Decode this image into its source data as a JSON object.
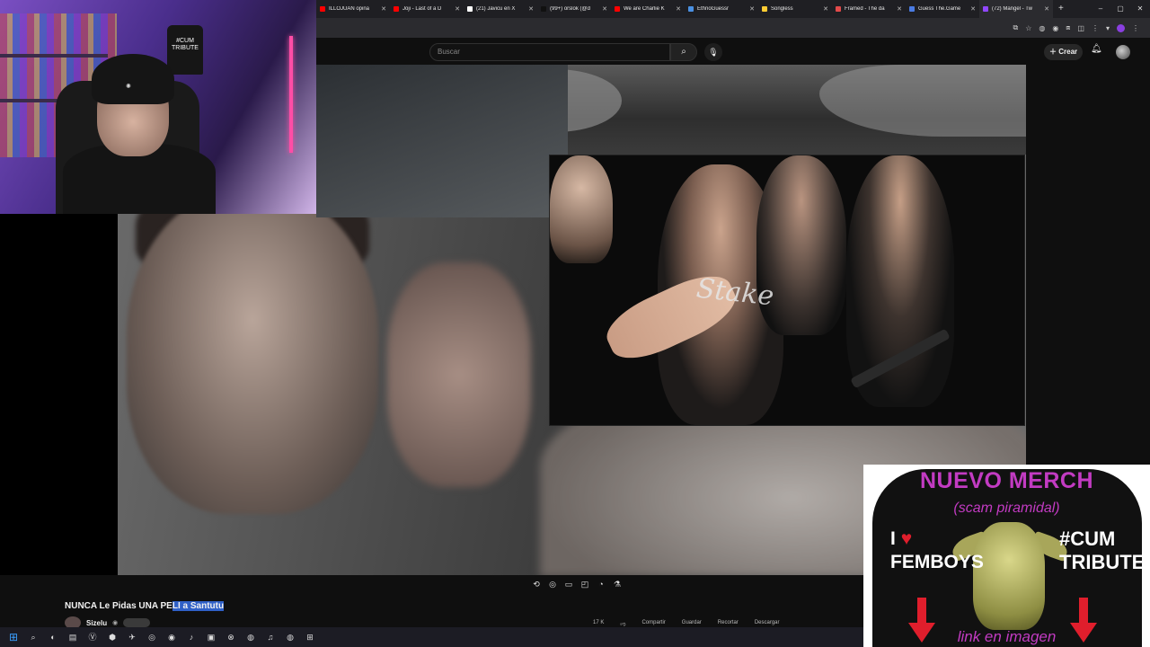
{
  "browser": {
    "tabs": [
      {
        "label": "ILLOJUAN opina",
        "color": "#ff0000"
      },
      {
        "label": "Joji - Last of a D",
        "color": "#ff0000"
      },
      {
        "label": "(21) Javicu en X",
        "color": "#ffffff"
      },
      {
        "label": "(99+) orslok (@d",
        "color": "#111111"
      },
      {
        "label": "We are Charlie K",
        "color": "#ff0000"
      },
      {
        "label": "EthnoGuessr",
        "color": "#4a90e2"
      },
      {
        "label": "Songless",
        "color": "#ffcc33"
      },
      {
        "label": "Framed - The da",
        "color": "#e24a4a"
      },
      {
        "label": "Guess The.Game",
        "color": "#4a7be2"
      },
      {
        "label": "(72) Mangel - Tw",
        "color": "#9147ff"
      }
    ],
    "new_tab": "+",
    "window_controls": [
      "–",
      "▢",
      "✕"
    ]
  },
  "youtube": {
    "search_placeholder": "Buscar",
    "search_icon": "search-icon",
    "mic_icon": "mic-icon",
    "create_label": "Crear",
    "video_title_pre": "NUNCA Le Pidas UNA PE",
    "video_title_sel": "LI a Santutu",
    "channel_name": "Sizelu",
    "inset_shirt_text": "Stake",
    "actions": [
      "17 K",
      "",
      "Compartir",
      "Guardar",
      "Recortar",
      "Descargar"
    ]
  },
  "webcam": {
    "shirt_text": "#CUM TRIBUTE"
  },
  "merch": {
    "title": "NUEVO MERCH",
    "subtitle": "(scam piramidal)",
    "left_line1": "I",
    "left_heart": "♥",
    "left_line2": "FEMBOYS",
    "right_line1": "#CUM",
    "right_line2": "TRIBUTE",
    "link": "link en imagen",
    "accent": "#c23bc2",
    "arrow_color": "#e01e2c"
  },
  "taskbar_icons": [
    "windows-icon",
    "search-icon",
    "steam-icon",
    "edge-icon",
    "app-icon",
    "v-icon",
    "folder-icon",
    "telegram-icon",
    "obs-icon",
    "discord-icon",
    "tiktok-icon",
    "store-icon",
    "xbox-icon",
    "chrome-icon",
    "spotify-icon",
    "chrome-icon"
  ]
}
